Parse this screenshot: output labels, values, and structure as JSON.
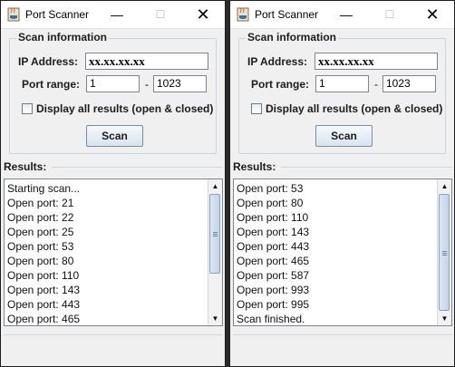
{
  "windows": [
    {
      "title": "Port Scanner",
      "minimize_glyph": "—",
      "maximize_glyph": "☐",
      "close_glyph": "✕",
      "scan_info": {
        "legend": "Scan information",
        "ip_label": "IP Address:",
        "ip_value": "xx.xx.xx.xx",
        "port_label": "Port range:",
        "port_from": "1",
        "port_dash": "-",
        "port_to": "1023",
        "checkbox_label": "Display all results (open & closed)",
        "checkbox_checked": false,
        "scan_button": "Scan"
      },
      "results": {
        "title": "Results:",
        "lines": [
          "Starting scan...",
          "Open port: 21",
          "Open port: 22",
          "Open port: 25",
          "Open port: 53",
          "Open port: 80",
          "Open port: 110",
          "Open port: 143",
          "Open port: 443",
          "Open port: 465"
        ],
        "scroll_position": 0.0
      },
      "scroll_up_glyph": "▲",
      "scroll_down_glyph": "▼"
    },
    {
      "title": "Port Scanner",
      "minimize_glyph": "—",
      "maximize_glyph": "☐",
      "close_glyph": "✕",
      "scan_info": {
        "legend": "Scan information",
        "ip_label": "IP Address:",
        "ip_value": "xx.xx.xx.xx",
        "port_label": "Port range:",
        "port_from": "1",
        "port_dash": "-",
        "port_to": "1023",
        "checkbox_label": "Display all results (open & closed)",
        "checkbox_checked": false,
        "scan_button": "Scan"
      },
      "results": {
        "title": "Results:",
        "lines": [
          "Open port: 53",
          "Open port: 80",
          "Open port: 110",
          "Open port: 143",
          "Open port: 443",
          "Open port: 465",
          "Open port: 587",
          "Open port: 993",
          "Open port: 995",
          "Scan finished."
        ],
        "scroll_position": 1.0
      },
      "scroll_up_glyph": "▲",
      "scroll_down_glyph": "▼"
    }
  ]
}
